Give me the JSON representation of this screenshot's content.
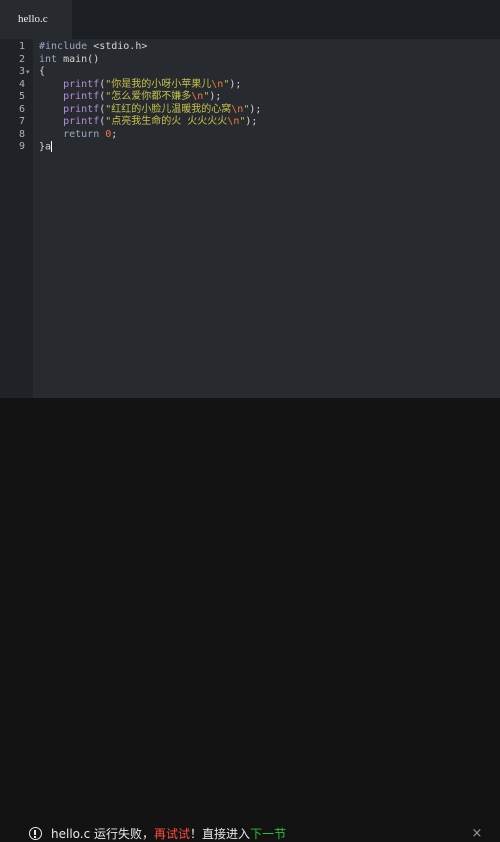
{
  "tab": {
    "title": "hello.c"
  },
  "editor": {
    "line_numbers": [
      "1",
      "2",
      "3",
      "4",
      "5",
      "6",
      "7",
      "8",
      "9"
    ],
    "fold_marker": "▾",
    "lines": [
      [
        {
          "t": "kw",
          "v": "#include "
        },
        {
          "t": "txt",
          "v": "<stdio.h>"
        }
      ],
      [
        {
          "t": "kw",
          "v": "int "
        },
        {
          "t": "txt",
          "v": "main()"
        }
      ],
      [
        {
          "t": "txt",
          "v": "{"
        }
      ],
      [
        {
          "t": "txt",
          "v": "    "
        },
        {
          "t": "fn",
          "v": "printf"
        },
        {
          "t": "txt",
          "v": "("
        },
        {
          "t": "str",
          "v": "\"你是我的小呀小苹果儿"
        },
        {
          "t": "esc",
          "v": "\\n"
        },
        {
          "t": "str",
          "v": "\""
        },
        {
          "t": "txt",
          "v": ");"
        }
      ],
      [
        {
          "t": "txt",
          "v": "    "
        },
        {
          "t": "fn",
          "v": "printf"
        },
        {
          "t": "txt",
          "v": "("
        },
        {
          "t": "str",
          "v": "\"怎么爱你都不嫌多"
        },
        {
          "t": "esc",
          "v": "\\n"
        },
        {
          "t": "str",
          "v": "\""
        },
        {
          "t": "txt",
          "v": ");"
        }
      ],
      [
        {
          "t": "txt",
          "v": "    "
        },
        {
          "t": "fn",
          "v": "printf"
        },
        {
          "t": "txt",
          "v": "("
        },
        {
          "t": "str",
          "v": "\"红红的小脸儿温暖我的心窝"
        },
        {
          "t": "esc",
          "v": "\\n"
        },
        {
          "t": "str",
          "v": "\""
        },
        {
          "t": "txt",
          "v": ");"
        }
      ],
      [
        {
          "t": "txt",
          "v": "    "
        },
        {
          "t": "fn",
          "v": "printf"
        },
        {
          "t": "txt",
          "v": "("
        },
        {
          "t": "str",
          "v": "\"点亮我生命的火 火火火火"
        },
        {
          "t": "esc",
          "v": "\\n"
        },
        {
          "t": "str",
          "v": "\""
        },
        {
          "t": "txt",
          "v": ");"
        }
      ],
      [
        {
          "t": "txt",
          "v": "    "
        },
        {
          "t": "kw",
          "v": "return "
        },
        {
          "t": "num",
          "v": "0"
        },
        {
          "t": "txt",
          "v": ";"
        }
      ],
      [
        {
          "t": "txt",
          "v": "}a"
        }
      ]
    ]
  },
  "notice": {
    "filename": "hello.c",
    "failed": " 运行失败，",
    "retry": "再试试",
    "bang": "！直接进入",
    "next": "下一节",
    "close": "×"
  }
}
